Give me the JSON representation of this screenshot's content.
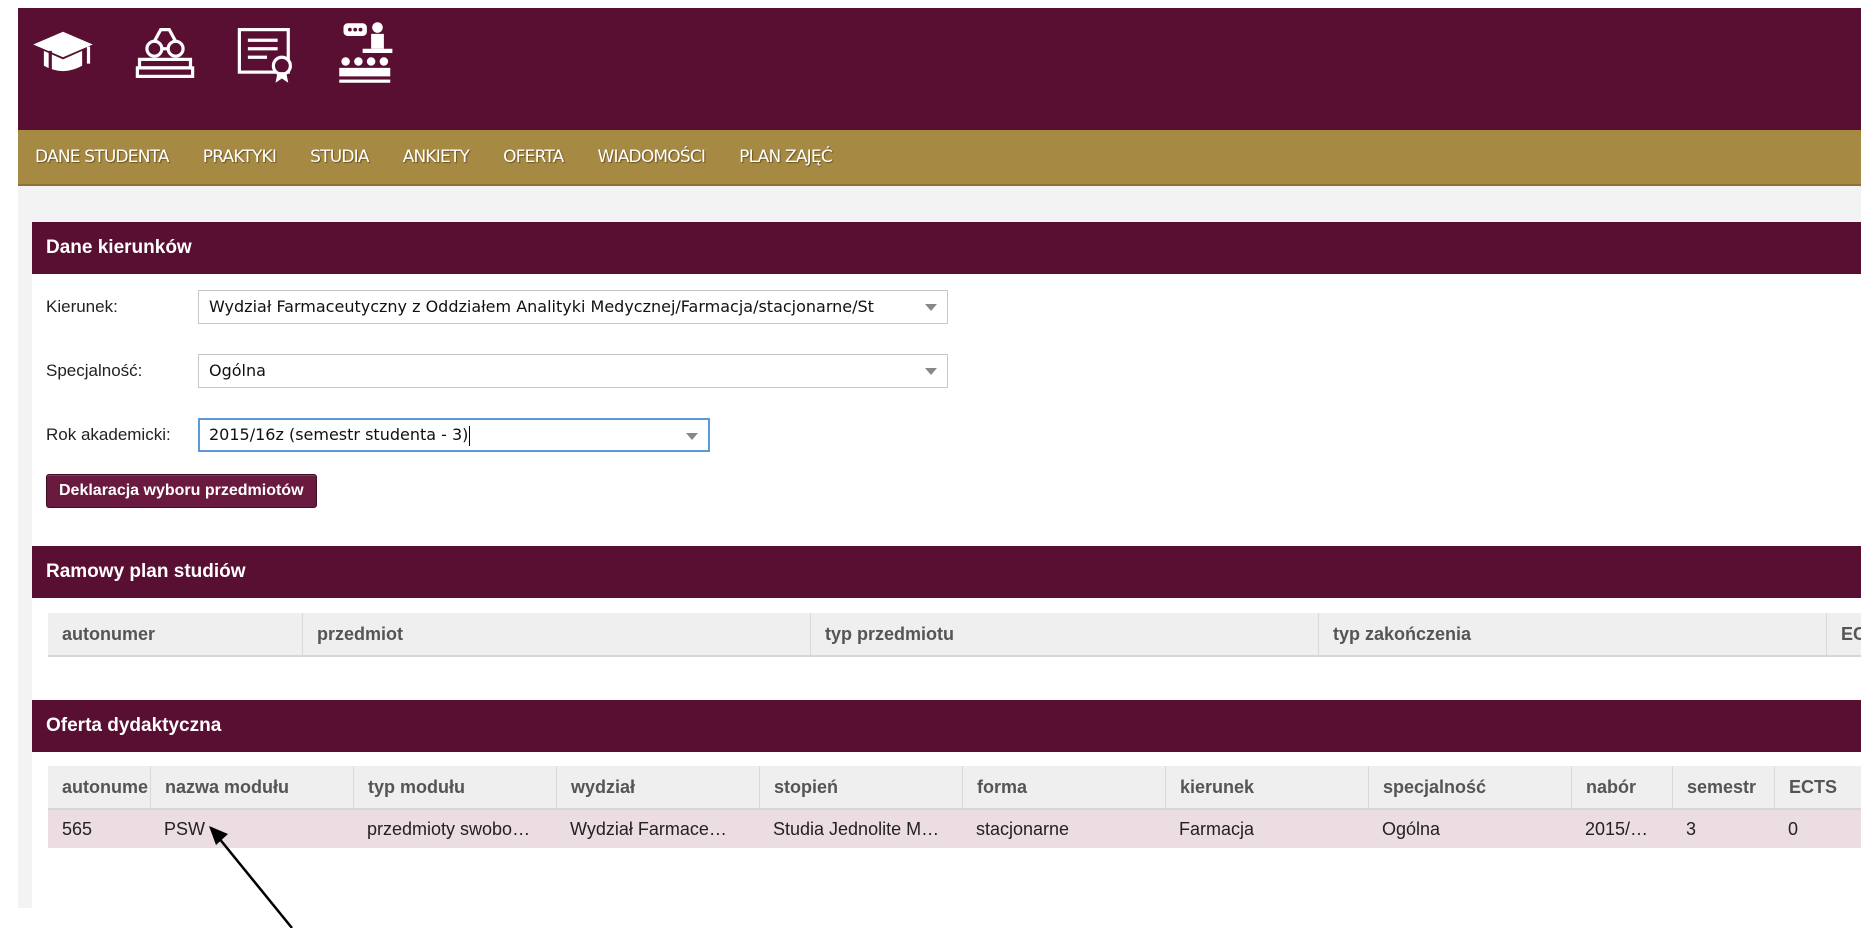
{
  "header": {
    "icons": [
      "graduation-cap-icon",
      "books-glasses-icon",
      "certificate-icon",
      "presentation-audience-icon"
    ]
  },
  "nav": {
    "items": [
      "DANE STUDENTA",
      "PRAKTYKI",
      "STUDIA",
      "ANKIETY",
      "OFERTA",
      "WIADOMOŚCI",
      "PLAN ZAJĘĆ"
    ]
  },
  "kierunki": {
    "title": "Dane kierunków",
    "kierunek_label": "Kierunek:",
    "kierunek_value": "Wydział Farmaceutyczny z Oddziałem Analityki Medycznej/Farmacja/stacjonarne/St",
    "specjalnosc_label": "Specjalność:",
    "specjalnosc_value": "Ogólna",
    "rok_label": "Rok akademicki:",
    "rok_value": "2015/16z (semestr studenta - 3)",
    "button": "Deklaracja wyboru przedmiotów"
  },
  "ramowy": {
    "title": "Ramowy plan studiów",
    "columns": [
      "autonumer",
      "przedmiot",
      "typ przedmiotu",
      "typ zakończenia",
      "EC"
    ]
  },
  "oferta": {
    "title": "Oferta dydaktyczna",
    "columns": [
      "autonume",
      "nazwa modułu",
      "typ modułu",
      "wydział",
      "stopień",
      "forma",
      "kierunek",
      "specjalność",
      "nabór",
      "semestr",
      "ECTS"
    ],
    "rows": [
      [
        "565",
        "PSW",
        "przedmioty swobo…",
        "Wydział Farmace…",
        "Studia Jednolite M…",
        "stacjonarne",
        "Farmacja",
        "Ogólna",
        "2015/…",
        "3",
        "0"
      ]
    ]
  },
  "colors": {
    "brand": "#590f31",
    "nav": "#a68942",
    "row_highlight": "#ecdde3"
  }
}
